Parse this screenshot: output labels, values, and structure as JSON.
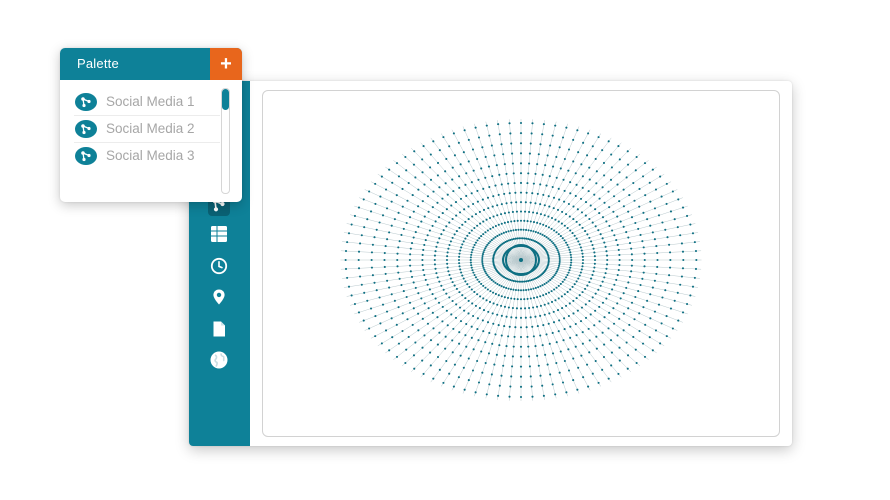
{
  "palette": {
    "title": "Palette",
    "add_label": "+",
    "items": [
      {
        "label": "Social Media 1",
        "icon": "graph-nodes-icon"
      },
      {
        "label": "Social Media 2",
        "icon": "graph-nodes-icon"
      },
      {
        "label": "Social Media 3",
        "icon": "graph-nodes-icon"
      }
    ]
  },
  "toolbar": {
    "tools": [
      {
        "icon": "graph-icon",
        "active": true
      },
      {
        "icon": "table-icon",
        "active": false
      },
      {
        "icon": "clock-icon",
        "active": false
      },
      {
        "icon": "map-pin-icon",
        "active": false
      },
      {
        "icon": "document-icon",
        "active": false
      },
      {
        "icon": "globe-icon",
        "active": false
      }
    ]
  },
  "graph": {
    "layout": "radial",
    "rings": 14,
    "spokes": 96,
    "colors": {
      "edge": "#b9c9cd",
      "node": "#0e6f82",
      "accent": "#0e8198"
    }
  },
  "colors": {
    "primary": "#0e8198",
    "add_button": "#e8661c",
    "label_text": "#a6a6a6"
  }
}
